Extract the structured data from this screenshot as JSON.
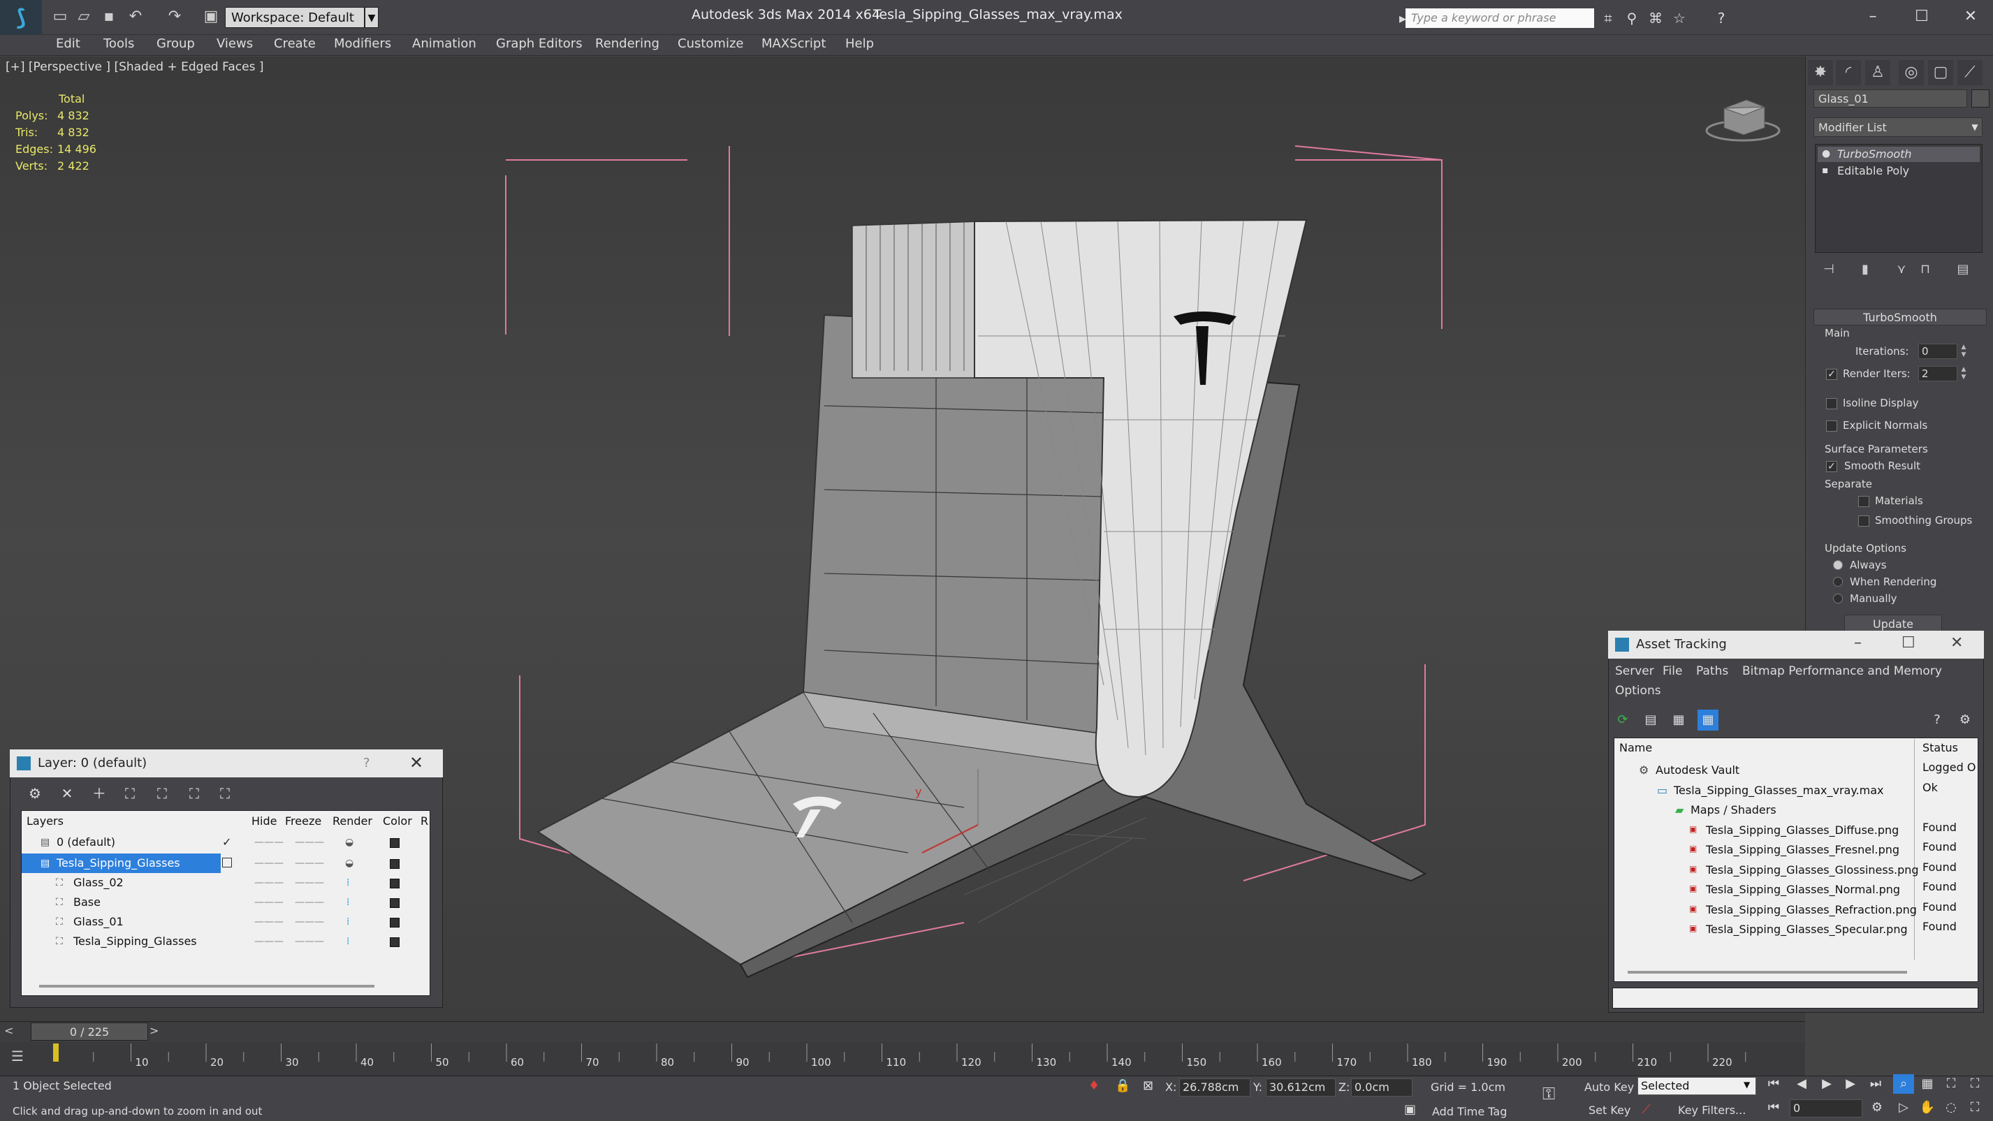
{
  "app": {
    "title": "Autodesk 3ds Max  2014 x64",
    "file": "Tesla_Sipping_Glasses_max_vray.max",
    "workspace": "Workspace: Default",
    "search_placeholder": "Type a keyword or phrase"
  },
  "menu": [
    "Edit",
    "Tools",
    "Group",
    "Views",
    "Create",
    "Modifiers",
    "Animation",
    "Graph Editors",
    "Rendering",
    "Customize",
    "MAXScript",
    "Help"
  ],
  "viewport": {
    "label": "[+] [Perspective ] [Shaded + Edged Faces ]",
    "stats": {
      "header": "Total",
      "rows": [
        {
          "label": "Polys:",
          "value": "4 832"
        },
        {
          "label": "Tris:",
          "value": "4 832"
        },
        {
          "label": "Edges:",
          "value": "14 496"
        },
        {
          "label": "Verts:",
          "value": "2 422"
        }
      ]
    }
  },
  "command_panel": {
    "object_name": "Glass_01",
    "modifier_list": "Modifier List",
    "stack": [
      "TurboSmooth",
      "Editable Poly"
    ],
    "rollout_title": "TurboSmooth",
    "main_label": "Main",
    "iterations_label": "Iterations:",
    "iterations_value": "0",
    "render_iters_label": "Render Iters:",
    "render_iters_value": "2",
    "isoline": "Isoline Display",
    "explicit_normals": "Explicit Normals",
    "surface_params": "Surface Parameters",
    "smooth_result": "Smooth Result",
    "separate": "Separate",
    "materials": "Materials",
    "smoothing_groups": "Smoothing Groups",
    "update_options": "Update Options",
    "always": "Always",
    "when_rendering": "When Rendering",
    "manually": "Manually",
    "update_button": "Update"
  },
  "layer_dialog": {
    "title": "Layer: 0 (default)",
    "help": "?",
    "columns": [
      "Layers",
      "Hide",
      "Freeze",
      "Render",
      "Color",
      "R"
    ],
    "rows": [
      {
        "name": "0 (default)"
      },
      {
        "name": "Tesla_Sipping_Glasses"
      },
      {
        "name": "Glass_02"
      },
      {
        "name": "Base"
      },
      {
        "name": "Glass_01"
      },
      {
        "name": "Tesla_Sipping_Glasses"
      }
    ]
  },
  "asset_tracking": {
    "title": "Asset Tracking",
    "menu": [
      "Server",
      "File",
      "Paths",
      "Bitmap Performance and Memory"
    ],
    "menu2": "Options",
    "columns": [
      "Name",
      "Status"
    ],
    "rows": [
      {
        "name": "Autodesk Vault",
        "status": "Logged O"
      },
      {
        "name": "Tesla_Sipping_Glasses_max_vray.max",
        "status": "Ok"
      },
      {
        "name": "Maps / Shaders",
        "status": ""
      },
      {
        "name": "Tesla_Sipping_Glasses_Diffuse.png",
        "status": "Found"
      },
      {
        "name": "Tesla_Sipping_Glasses_Fresnel.png",
        "status": "Found"
      },
      {
        "name": "Tesla_Sipping_Glasses_Glossiness.png",
        "status": "Found"
      },
      {
        "name": "Tesla_Sipping_Glasses_Normal.png",
        "status": "Found"
      },
      {
        "name": "Tesla_Sipping_Glasses_Refraction.png",
        "status": "Found"
      },
      {
        "name": "Tesla_Sipping_Glasses_Specular.png",
        "status": "Found"
      }
    ]
  },
  "timeline": {
    "frame": "0 / 225",
    "ticks": [
      "10",
      "20",
      "30",
      "40",
      "50",
      "60",
      "70",
      "80",
      "90",
      "100",
      "110",
      "120",
      "130",
      "140",
      "150",
      "160",
      "170",
      "180",
      "190",
      "200",
      "210",
      "220"
    ]
  },
  "status": {
    "selection": "1 Object Selected",
    "prompt": "Click and drag up-and-down to zoom in and out",
    "x_label": "X:",
    "x": "26.788cm",
    "y_label": "Y:",
    "y": "30.612cm",
    "z_label": "Z:",
    "z": "0.0cm",
    "grid": "Grid = 1.0cm",
    "auto_key": "Auto Key",
    "set_key": "Set Key",
    "selected": "Selected",
    "key_filters": "Key Filters...",
    "add_time_tag": "Add Time Tag",
    "frame_value": "0"
  }
}
